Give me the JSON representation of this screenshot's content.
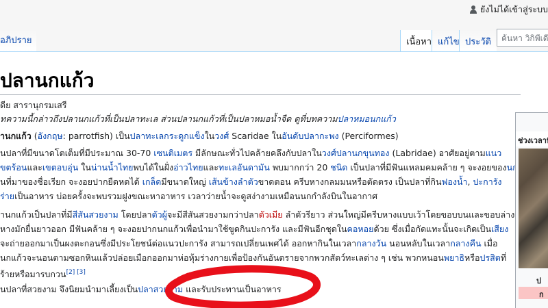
{
  "header": {
    "user_link": "ยังไม่ได้เข้าสู่ระบบ",
    "discussion_tab": "อภิปราย",
    "tabs": [
      {
        "label": "เนื้อหา"
      },
      {
        "label": "แก้ไข"
      },
      {
        "label": "ประวัติ"
      }
    ],
    "search_placeholder": "ค้นหา วิกิพีเดีย"
  },
  "article": {
    "title": "ปลานกแก้ว",
    "from": "ดีย สารานุกรมเสรี",
    "hatnote_a": "ทความนี้กล่าวถึงปลานกแก้วที่เป็นปลาทะเล ส่วนปลานกแก้วที่เป็นปลาหมอน้ำจืด ดูที่บทความ",
    "hatnote_link": "ปลาหมอนกแก้ว",
    "p1_bold": "านกแก้ว",
    "p1_a": " (",
    "p1_lang": "อังกฤษ",
    "p1_b": ": parrotfish) เป็น",
    "p1_l1": "ปลาทะเลกระดูกแข็ง",
    "p1_c": "ใน",
    "p1_l2": "วงศ์",
    "p1_d": " Scaridae ใน",
    "p1_l3": "อันดับปลากะพง",
    "p1_e": " (Perciformes)",
    "p2": [
      {
        "segs": [
          {
            "t": "นปลาที่มีขนาดโตเต็มที่มีประมาณ 30-70 "
          },
          {
            "t": "เซนติเมตร",
            "c": "link"
          },
          {
            "t": " มีลักษณะทั่วไปคล้ายคลึงกับปลาใน"
          },
          {
            "t": "วงศ์ปลานกขุนทอง",
            "c": "link"
          },
          {
            "t": " (Labridae) อาศัยอยู่ตาม"
          },
          {
            "t": "แนว",
            "c": "link"
          }
        ]
      },
      {
        "segs": [
          {
            "t": "ขตร้อน",
            "c": "link"
          },
          {
            "t": "และ"
          },
          {
            "t": "เขตอบอุ่น",
            "c": "link"
          },
          {
            "t": " ใน"
          },
          {
            "t": "น่านน้ำไทย",
            "c": "link"
          },
          {
            "t": "พบได้ในฝั่ง"
          },
          {
            "t": "อ่าวไทย",
            "c": "link"
          },
          {
            "t": "และ"
          },
          {
            "t": "ทะเลอันดามัน",
            "c": "link"
          },
          {
            "t": " พบมากกว่า 20 "
          },
          {
            "t": "ชนิด",
            "c": "link"
          },
          {
            "t": " เป็นปลาที่มีฟันแหลมคมคล้าย ๆ จะงอยของ"
          },
          {
            "t": "นก",
            "c": "link"
          }
        ]
      },
      {
        "segs": [
          {
            "t": "นที่มาของชื่อเรียก จะงอยปากยืดหดได้ "
          },
          {
            "t": "เกล็ด",
            "c": "link"
          },
          {
            "t": "มีขนาดใหญ่ "
          },
          {
            "t": "เส้นข้างลำตัว",
            "c": "link"
          },
          {
            "t": "ขาดตอน ครีบหางกลมมนหรือตัดตรง เป็นปลาที่กิน"
          },
          {
            "t": "ฟองน้ำ",
            "c": "link"
          },
          {
            "t": ", "
          },
          {
            "t": "ปะการัง",
            "c": "link"
          }
        ]
      },
      {
        "segs": [
          {
            "t": "ร่าย",
            "c": "link"
          },
          {
            "t": "เป็นอาหาร บ่อยครั้งจะพบรวมฝูงขณะหาอาหาร เวลาว่ายน้ำจะดูสง่างามเหมือนนกกำลังบินในอากาศ"
          }
        ]
      }
    ],
    "p3": [
      {
        "segs": [
          {
            "t": "านกแก้วเป็นปลาที่มี"
          },
          {
            "t": "สีสันสวยงาม",
            "c": "link"
          },
          {
            "t": " โดยปลา"
          },
          {
            "t": "ตัวผู้",
            "c": "link"
          },
          {
            "t": "จะมีสีสันสวยงามกว่าปลา"
          },
          {
            "t": "ตัวเมีย",
            "c": "red"
          },
          {
            "t": " ลำตัวรียาว ส่วนใหญ่มีครีบหางแบบเว้าโดยขอบบนและขอบล่าง"
          }
        ]
      },
      {
        "segs": [
          {
            "t": "หางมักยื่นยาวออก มีฟันคล้าย ๆ จะงอยปากนกแก้วเพื่อนำมาใช้ขูดกินปะการัง และมีฟันอีกชุดใน"
          },
          {
            "t": "คอหอย",
            "c": "link"
          },
          {
            "t": "ด้วย ซึ่งเมื่อกัดแทะนั้นจะเกิดเป็น"
          },
          {
            "t": "เสียง",
            "c": "link"
          }
        ]
      },
      {
        "segs": [
          {
            "t": "จะถ่ายออกมาเป็นผงตะกอนซึ่งมีประโยชน์ต่อแนวปะการัง สามารถเปลี่ยนเพศได้ ออกหากินในเวลา"
          },
          {
            "t": "กลางวัน",
            "c": "link"
          },
          {
            "t": " นอนหลับในเวลา"
          },
          {
            "t": "กลางคืน",
            "c": "link"
          },
          {
            "t": " เมื่อ"
          }
        ]
      },
      {
        "segs": [
          {
            "t": "นกแก้วจะนอนตามซอกหินแล้วปล่อยเมือกออกมาห่อหุ้มร่างกายเพื่อป้องกันอันตรายจากพวกสัตว์ทะเลต่าง ๆ เช่น พวกหนอน"
          },
          {
            "t": "พยาธิ",
            "c": "link"
          },
          {
            "t": "หรือ"
          },
          {
            "t": "ปรสิต",
            "c": "link"
          },
          {
            "t": "ที่"
          }
        ]
      },
      {
        "segs": [
          {
            "t": "ร้ายหรือมารบกวน"
          },
          {
            "t": "[2] [3]",
            "c": "sup"
          }
        ]
      }
    ],
    "p4_a": "นปลาที่สวยงาม จึงนิยมนำมาเลี้ยงเป็น",
    "p4_link": "ปลาสวยงาม",
    "p4_b": " และรับประทานเป็นอาหาร"
  },
  "infobox": {
    "header": "ช่วงเวลาที่มีชีวิตอยู่",
    "caption": "ป",
    "pink_label": "ก"
  },
  "annotation": {
    "color": "#e8101a"
  }
}
